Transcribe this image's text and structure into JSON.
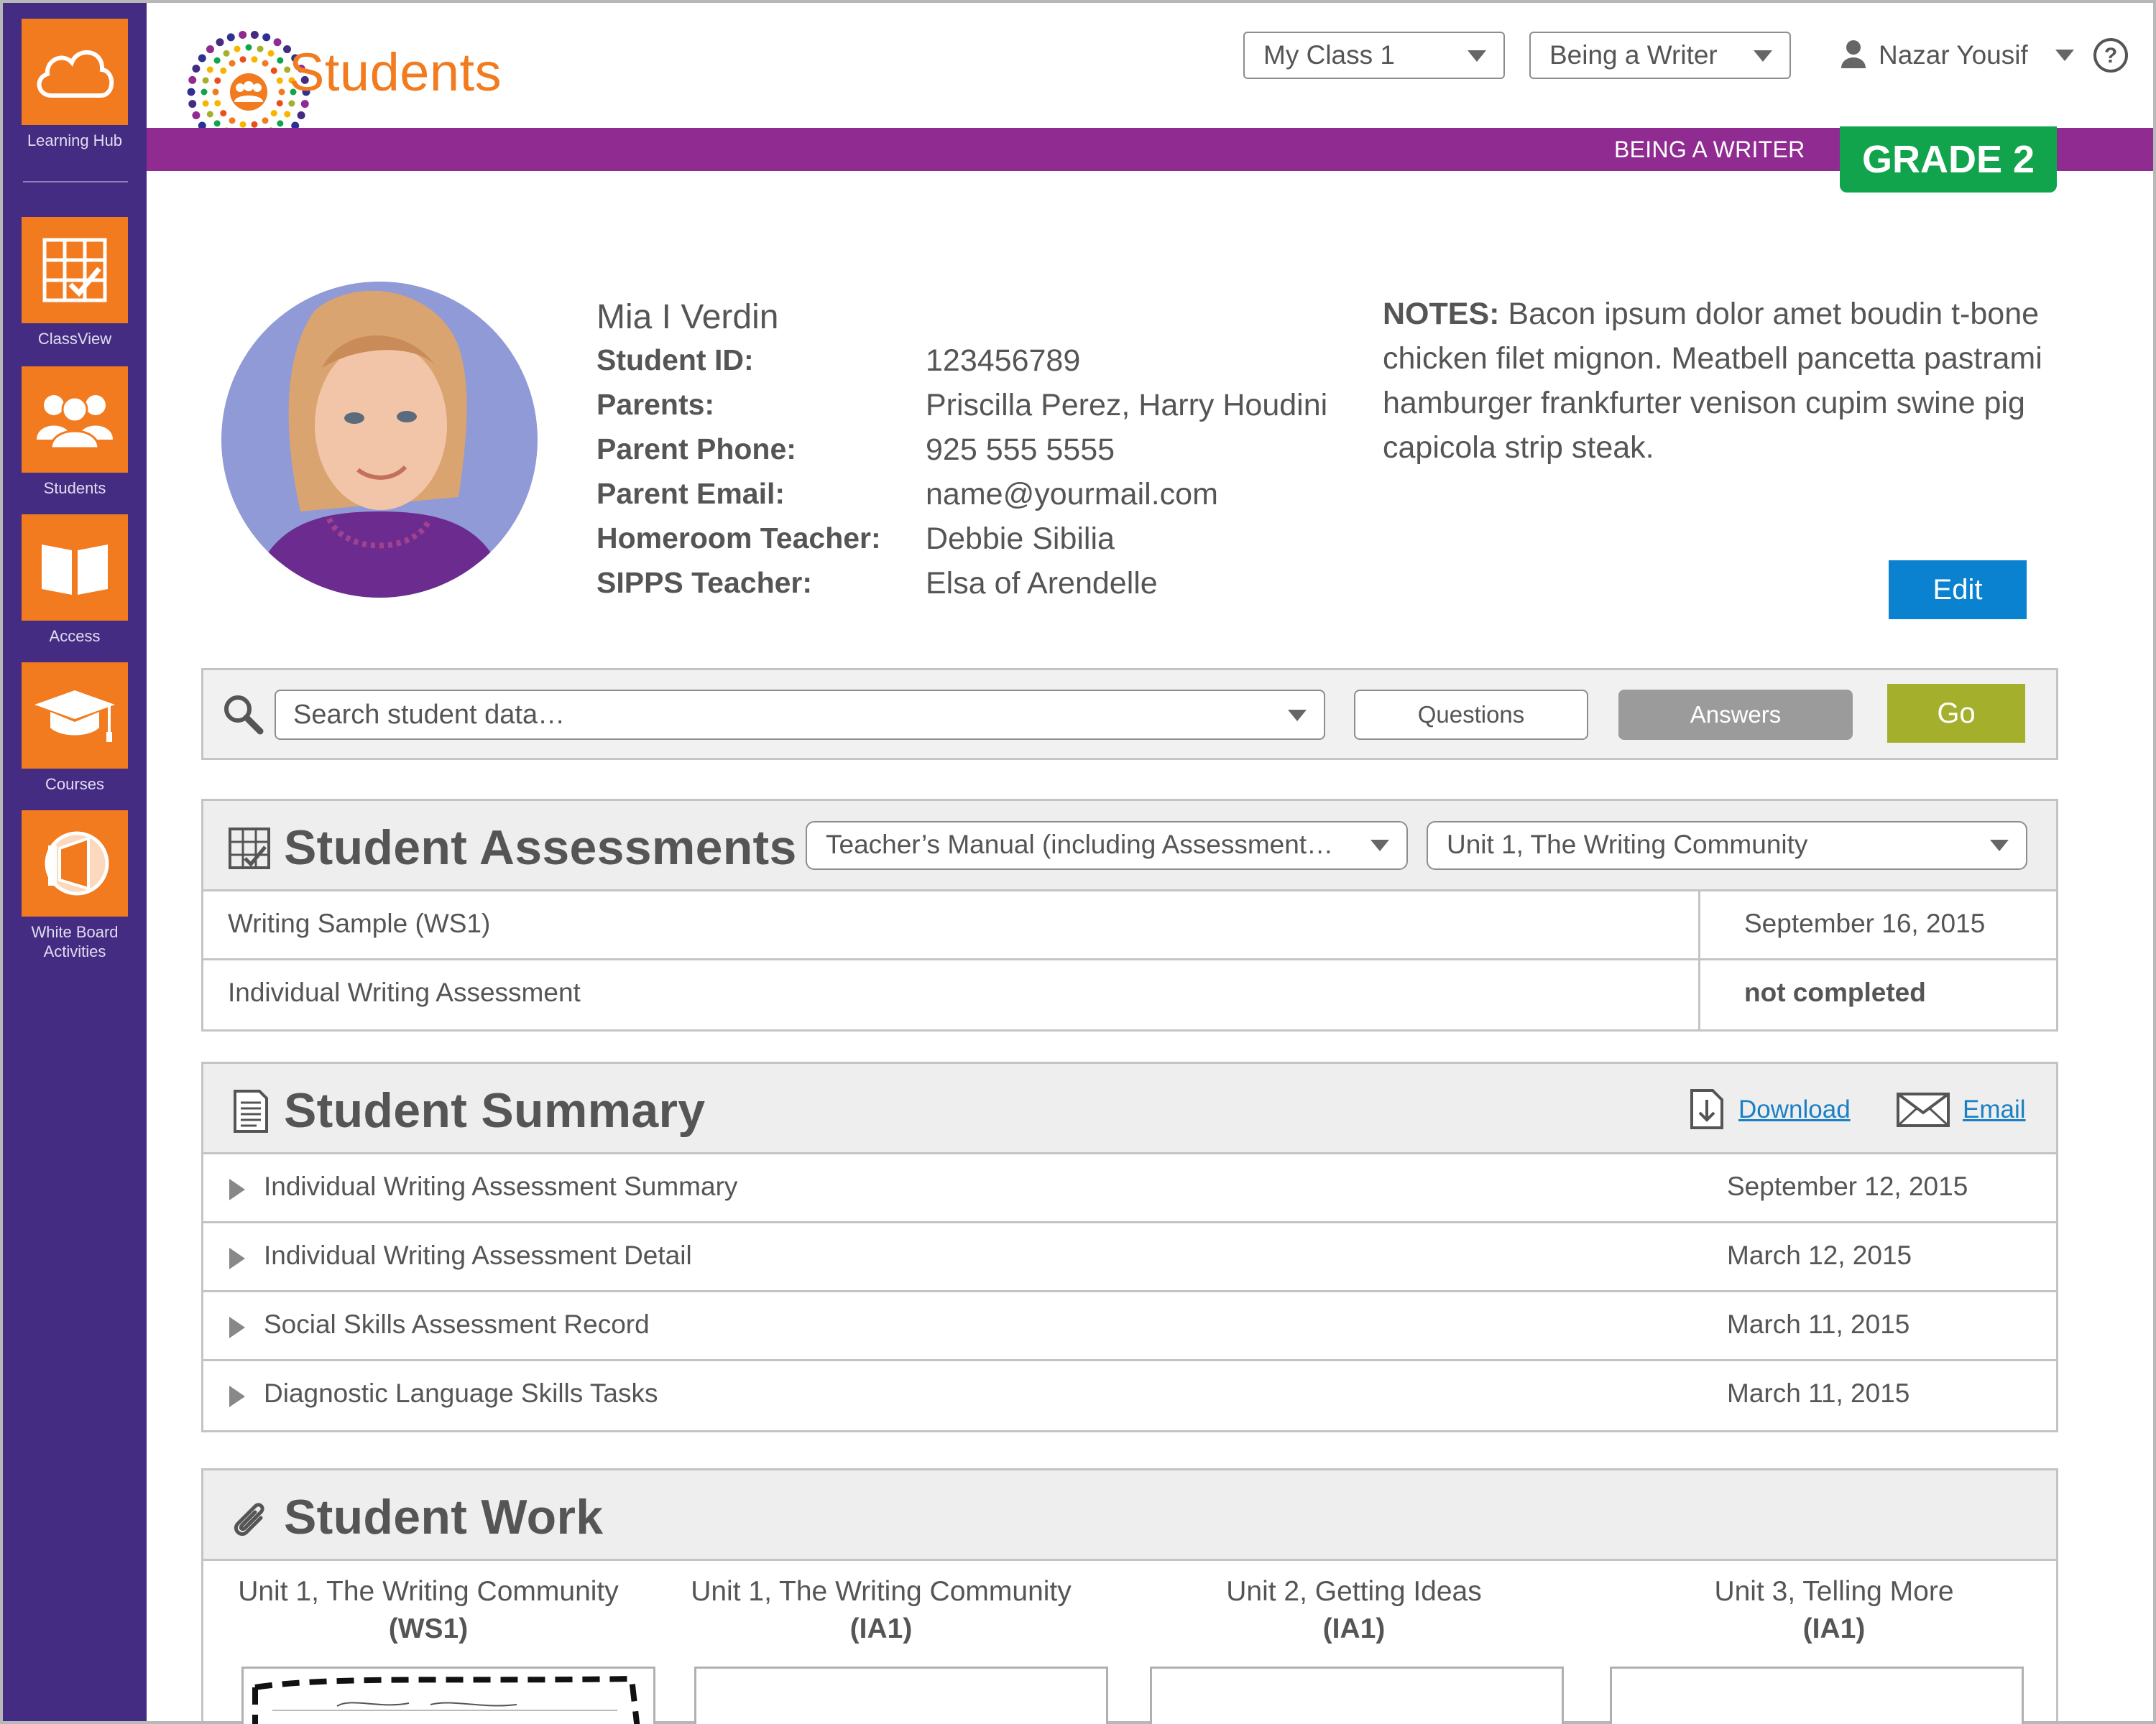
{
  "sidebar": {
    "items": [
      {
        "label": "Learning Hub",
        "icon": "cloud-icon"
      },
      {
        "label": "ClassView",
        "icon": "classview-grid-icon"
      },
      {
        "label": "Students",
        "icon": "students-group-icon"
      },
      {
        "label": "Access",
        "icon": "open-book-icon"
      },
      {
        "label": "Courses",
        "icon": "graduation-cap-icon"
      },
      {
        "label_line1": "White Board",
        "label_line2": "Activities",
        "icon": "whiteboard-icon"
      }
    ]
  },
  "header": {
    "title": "Students",
    "class_select": "My Class 1",
    "program_select": "Being a Writer",
    "user_name": "Nazar Yousif",
    "band_text": "BEING A WRITER",
    "grade": "GRADE 2"
  },
  "profile": {
    "name": "Mia I Verdin",
    "fields": [
      {
        "label": "Student ID:",
        "value": "123456789"
      },
      {
        "label": "Parents:",
        "value": "Priscilla Perez, Harry Houdini"
      },
      {
        "label": "Parent Phone:",
        "value": "925 555 5555"
      },
      {
        "label": "Parent Email:",
        "value": "name@yourmail.com"
      },
      {
        "label": "Homeroom Teacher:",
        "value": "Debbie Sibilia"
      },
      {
        "label": "SIPPS Teacher:",
        "value": "Elsa of Arendelle"
      }
    ],
    "notes_label": "NOTES:",
    "notes_text": "Bacon ipsum dolor amet boudin t-bone chicken filet mignon. Meatbell pancetta pastrami hamburger frankfurter venison cupim swine pig capicola strip steak.",
    "edit_label": "Edit"
  },
  "search": {
    "placeholder": "Search student data…",
    "questions_label": "Questions",
    "answers_label": "Answers",
    "go_label": "Go"
  },
  "assessments": {
    "title": "Student Assessments",
    "manual_select": "Teacher’s Manual (including Assessment…",
    "unit_select": "Unit 1, The Writing Community",
    "rows": [
      {
        "label": "Writing Sample (WS1)",
        "status": "September 16, 2015"
      },
      {
        "label": "Individual Writing Assessment",
        "status": "not completed"
      }
    ]
  },
  "summary": {
    "title": "Student Summary",
    "download_label": "Download",
    "email_label": "Email",
    "rows": [
      {
        "label": "Individual Writing Assessment Summary",
        "date": "September 12, 2015"
      },
      {
        "label": "Individual Writing Assessment Detail",
        "date": "March 12, 2015"
      },
      {
        "label": "Social Skills Assessment Record",
        "date": "March 11, 2015"
      },
      {
        "label": "Diagnostic Language Skills Tasks",
        "date": "March 11, 2015"
      }
    ]
  },
  "work": {
    "title": "Student Work",
    "items": [
      {
        "unit": "Unit 1, The Writing Community",
        "code": "(WS1)"
      },
      {
        "unit": "Unit 1, The Writing Community",
        "code": "(IA1)"
      },
      {
        "unit": "Unit 2, Getting Ideas",
        "code": "(IA1)"
      },
      {
        "unit": "Unit 3, Telling More",
        "code": "(IA1)"
      }
    ]
  },
  "colors": {
    "sidebar": "#432c81",
    "accent_orange": "#f27a1f",
    "band_purple": "#8f2b91",
    "grade_green": "#11a44c",
    "edit_blue": "#0b82cf",
    "go_green": "#a4b02b"
  }
}
